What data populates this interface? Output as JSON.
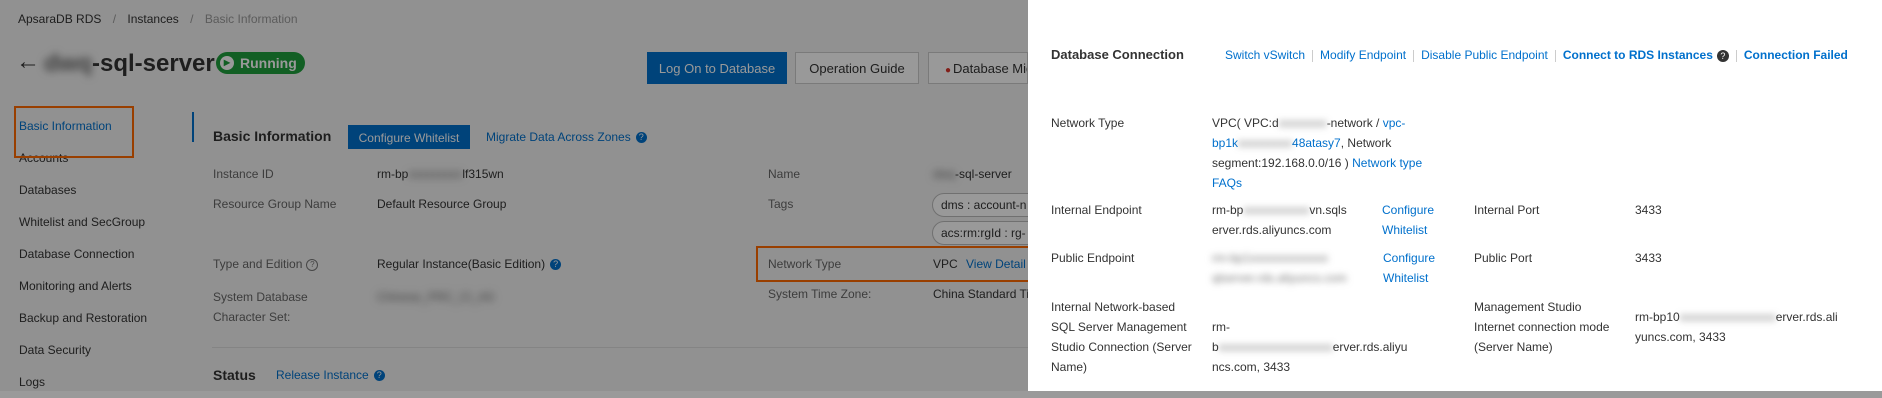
{
  "breadcrumb": {
    "items": [
      "ApsaraDB RDS",
      "Instances",
      "Basic Information"
    ],
    "sep": "/"
  },
  "instance": {
    "title_blurred": "dwq",
    "title_suffix": "-sql-server",
    "status": "Running"
  },
  "icons": {
    "back": "←",
    "play": "▶",
    "help": "?",
    "record": "●"
  },
  "top_buttons": {
    "logon": "Log On to Database",
    "guide": "Operation Guide",
    "migrate": "Database Mig"
  },
  "nav": [
    "Basic Information",
    "Accounts",
    "Databases",
    "Whitelist and SecGroup",
    "Database Connection",
    "Monitoring and Alerts",
    "Backup and Restoration",
    "Data Security",
    "Logs"
  ],
  "basic": {
    "title": "Basic Information",
    "configure_whitelist": "Configure Whitelist",
    "migrate_zones": "Migrate Data Across Zones",
    "fields": {
      "instance_id_label": "Instance ID",
      "instance_id_a": "rm-bp",
      "instance_id_b": "xxxxxxxxx",
      "instance_id_c": "lf315wn",
      "rg_label": "Resource Group Name",
      "rg_value": "Default Resource Group",
      "edition_label": "Type and Edition",
      "edition_value": "Regular Instance(Basic Edition)",
      "charset_label": "System Database Character Set:",
      "charset_value": "Chinese_PRC_CI_AS",
      "name_label": "Name",
      "name_a": "dwq",
      "name_b": "-sql-server",
      "tags_label": "Tags",
      "tag1": "dms : account-n",
      "tag2": "acs:rm:rgId : rg-",
      "network_label": "Network Type",
      "network_value": "VPC",
      "view_details": "View Detail",
      "timezone_label": "System Time Zone:",
      "timezone_value": "China Standard Ti"
    }
  },
  "status_section": {
    "title": "Status",
    "release": "Release Instance"
  },
  "panel": {
    "title": "Database Connection",
    "actions": [
      "Switch vSwitch",
      "Modify Endpoint",
      "Disable Public Endpoint",
      "Connect to RDS Instances",
      "Connection Failed"
    ],
    "network_type_label": "Network Type",
    "nt": {
      "line1_a": "VPC( VPC:d",
      "line1_b": "xxxxxxxx",
      "line1_c": "-network / ",
      "line1_d": "vpc-",
      "line2_a": "bp1k",
      "line2_b": "xxxxxxxxx",
      "line2_c": "48atasy7",
      "line2_d": ", Network",
      "line3_a": "segment:192.168.0.0/16 ) ",
      "line3_b": "Network type",
      "line4": "FAQs"
    },
    "internal_endpoint_label": "Internal Endpoint",
    "internal_endpoint_1a": "rm-bp",
    "internal_endpoint_1b": "xxxxxxxxxxx",
    "internal_endpoint_1c": "vn.sqls",
    "internal_endpoint_2": "erver.rds.aliyuncs.com",
    "configure_1": "Configure",
    "whitelist": "Whitelist",
    "internal_port_label": "Internal Port",
    "internal_port": "3433",
    "public_endpoint_label": "Public Endpoint",
    "public_endpoint_1": "rm-bp1xxxxxxxxxxxxx",
    "public_endpoint_2": "qlserver.rds.aliyuncs.com",
    "public_port_label": "Public Port",
    "public_port": "3433",
    "ssms_label_lines": [
      "Internal Network-based",
      "SQL Server Management",
      "Studio Connection (Server",
      "Name)"
    ],
    "ssms_value_1a": "rm-b",
    "ssms_value_1b": "xxxxxxxxxxxxxxxxxxx",
    "ssms_value_1c": "erver.rds.aliyu",
    "ssms_value_2": "ncs.com, 3433",
    "mgmt_label_lines": [
      "Management Studio",
      "Internet connection mode",
      "(Server Name)"
    ],
    "mgmt_value_1a": "rm-bp10",
    "mgmt_value_1b": "xxxxxxxxxxxxxxxx",
    "mgmt_value_1c": "erver.rds.ali",
    "mgmt_value_2": "yuncs.com, 3433"
  },
  "colors": {
    "accent": "#0070cc",
    "highlight": "#ff6a00",
    "running": "#1e9e3c"
  }
}
